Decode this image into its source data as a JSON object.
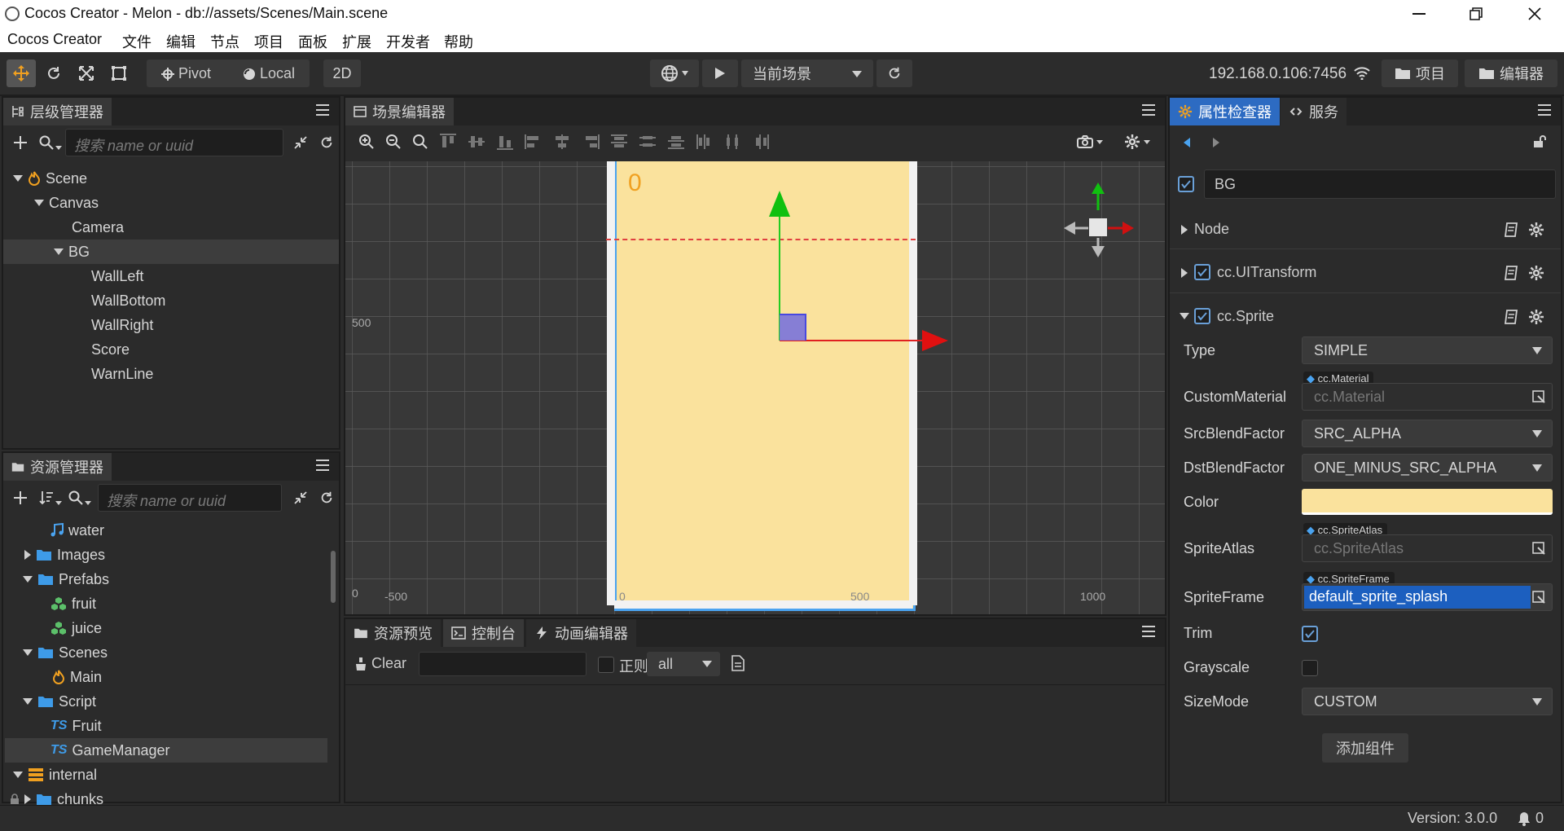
{
  "window": {
    "title": "Cocos Creator - Melon - db://assets/Scenes/Main.scene"
  },
  "menu": [
    "Cocos Creator",
    "文件",
    "编辑",
    "节点",
    "项目",
    "面板",
    "扩展",
    "开发者",
    "帮助"
  ],
  "toolbar": {
    "pivot_label": "Pivot",
    "local_label": "Local",
    "mode_2d": "2D",
    "scene_select": "当前场景",
    "ip_address": "192.168.0.106:7456",
    "project_button": "项目",
    "editor_button": "编辑器"
  },
  "hierarchy": {
    "tab_label": "层级管理器",
    "search_placeholder": "搜索 name or uuid",
    "nodes": [
      "Scene",
      "Canvas",
      "Camera",
      "BG",
      "WallLeft",
      "WallBottom",
      "WallRight",
      "Score",
      "WarnLine"
    ]
  },
  "assets": {
    "tab_label": "资源管理器",
    "search_placeholder": "搜索 name or uuid",
    "items": [
      "water",
      "Images",
      "Prefabs",
      "fruit",
      "juice",
      "Scenes",
      "Main",
      "Script",
      "Fruit",
      "GameManager",
      "internal",
      "chunks"
    ],
    "ts_badge": "TS"
  },
  "scene_editor": {
    "tab_label": "场景编辑器",
    "score_text": "0",
    "axis_labels": [
      "500",
      "0",
      "-500",
      "0",
      "500",
      "1000"
    ]
  },
  "bottom_panel": {
    "tabs": [
      "资源预览",
      "控制台",
      "动画编辑器"
    ],
    "clear_label": "Clear",
    "regex_label": "正则",
    "filter_value": "all"
  },
  "inspector": {
    "tabs": [
      "属性检查器",
      "服务"
    ],
    "node_name": "BG",
    "sections": [
      "Node",
      "cc.UITransform",
      "cc.Sprite"
    ],
    "props": {
      "type_label": "Type",
      "type_value": "SIMPLE",
      "custom_material_label": "CustomMaterial",
      "custom_material_badge": "cc.Material",
      "custom_material_value": "cc.Material",
      "src_blend_label": "SrcBlendFactor",
      "src_blend_value": "SRC_ALPHA",
      "dst_blend_label": "DstBlendFactor",
      "dst_blend_value": "ONE_MINUS_SRC_ALPHA",
      "color_label": "Color",
      "color_value": "#FAE29D",
      "sprite_atlas_label": "SpriteAtlas",
      "sprite_atlas_badge": "cc.SpriteAtlas",
      "sprite_atlas_value": "cc.SpriteAtlas",
      "sprite_frame_label": "SpriteFrame",
      "sprite_frame_badge": "cc.SpriteFrame",
      "sprite_frame_value": "default_sprite_splash",
      "trim_label": "Trim",
      "trim_checked": true,
      "grayscale_label": "Grayscale",
      "grayscale_checked": false,
      "size_mode_label": "SizeMode",
      "size_mode_value": "CUSTOM"
    },
    "add_component": "添加组件"
  },
  "status": {
    "version": "Version: 3.0.0",
    "notifications": "0"
  },
  "colors": {
    "accent": "#2d6bc2",
    "canvas_bg": "#FAE29D",
    "score_color": "#f0a020"
  }
}
